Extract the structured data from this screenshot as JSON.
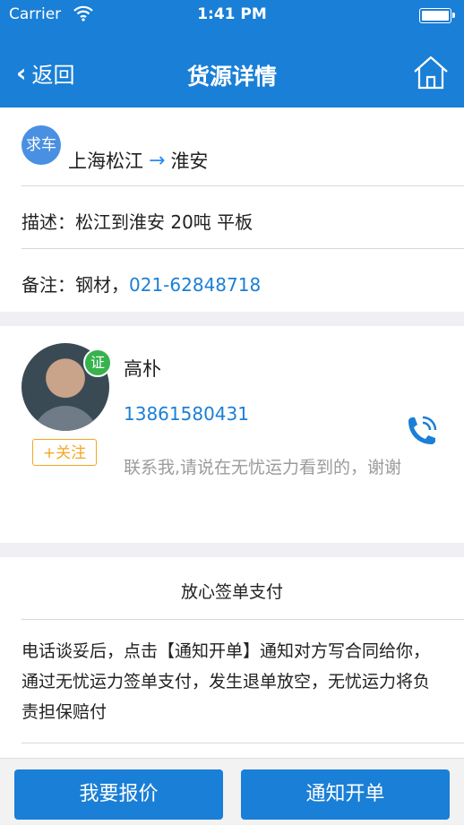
{
  "status_bar": {
    "carrier": "Carrier",
    "time": "1:41 PM"
  },
  "nav": {
    "back_label": "返回",
    "title": "货源详情"
  },
  "route": {
    "badge": "求车",
    "from": "上海松江",
    "to": "淮安"
  },
  "description": {
    "label": "描述：",
    "value": "松江到淮安 20吨 平板"
  },
  "note": {
    "label": "备注：",
    "value": "钢材，",
    "phone": "021-62848718"
  },
  "contact": {
    "verified_badge": "证",
    "follow_label": "+关注",
    "name": "高朴",
    "phone": "13861580431",
    "message": "联系我,请说在无忧运力看到的，谢谢"
  },
  "payment": {
    "title": "放心签单支付",
    "body": "电话谈妥后，点击【通知开单】通知对方写合同给你，通过无忧运力签单支付，发生退单放空，无忧运力将负责担保赔付"
  },
  "actions": {
    "quote_label": "我要报价",
    "notify_label": "通知开单"
  },
  "colors": {
    "primary": "#1a7fd6",
    "accent": "#f5a623",
    "verified": "#37b24d"
  }
}
